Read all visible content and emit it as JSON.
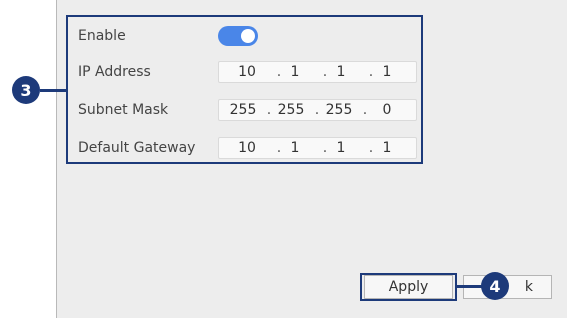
{
  "form": {
    "enable_label": "Enable",
    "enable_state": true,
    "ip_label": "IP Address",
    "ip": [
      "10",
      "1",
      "1",
      "1"
    ],
    "subnet_label": "Subnet Mask",
    "subnet": [
      "255",
      "255",
      "255",
      "0"
    ],
    "gateway_label": "Default Gateway",
    "gateway": [
      "10",
      "1",
      "1",
      "1"
    ],
    "separator": "."
  },
  "callouts": {
    "one": "3",
    "two": "4"
  },
  "buttons": {
    "apply": "Apply",
    "back_visible": "k"
  },
  "colors": {
    "accent": "#4a86e8",
    "callout": "#1d3a7a",
    "panel": "#ededed"
  }
}
